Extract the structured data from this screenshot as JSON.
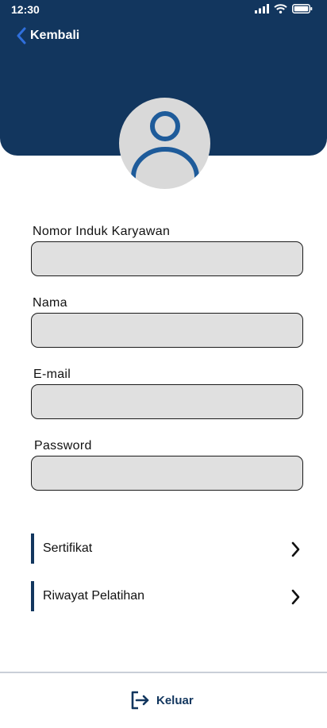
{
  "status_bar": {
    "time": "12:30"
  },
  "header": {
    "back_label": "Kembali"
  },
  "form": {
    "fields": [
      {
        "label": "Nomor Induk Karyawan",
        "value": ""
      },
      {
        "label": "Nama",
        "value": ""
      },
      {
        "label": "E-mail",
        "value": ""
      },
      {
        "label": "Password",
        "value": ""
      }
    ]
  },
  "menu": {
    "items": [
      {
        "label": "Sertifikat"
      },
      {
        "label": "Riwayat Pelatihan"
      }
    ]
  },
  "footer": {
    "logout_label": "Keluar"
  },
  "colors": {
    "primary": "#12365e",
    "accent": "#2f6fdc",
    "avatar_figure": "#1e5b9a",
    "input_bg": "#e0e0e0"
  },
  "icons": [
    "signal-icon",
    "wifi-icon",
    "battery-icon",
    "back-chevron-icon",
    "user-icon",
    "chevron-right-icon",
    "logout-icon"
  ]
}
